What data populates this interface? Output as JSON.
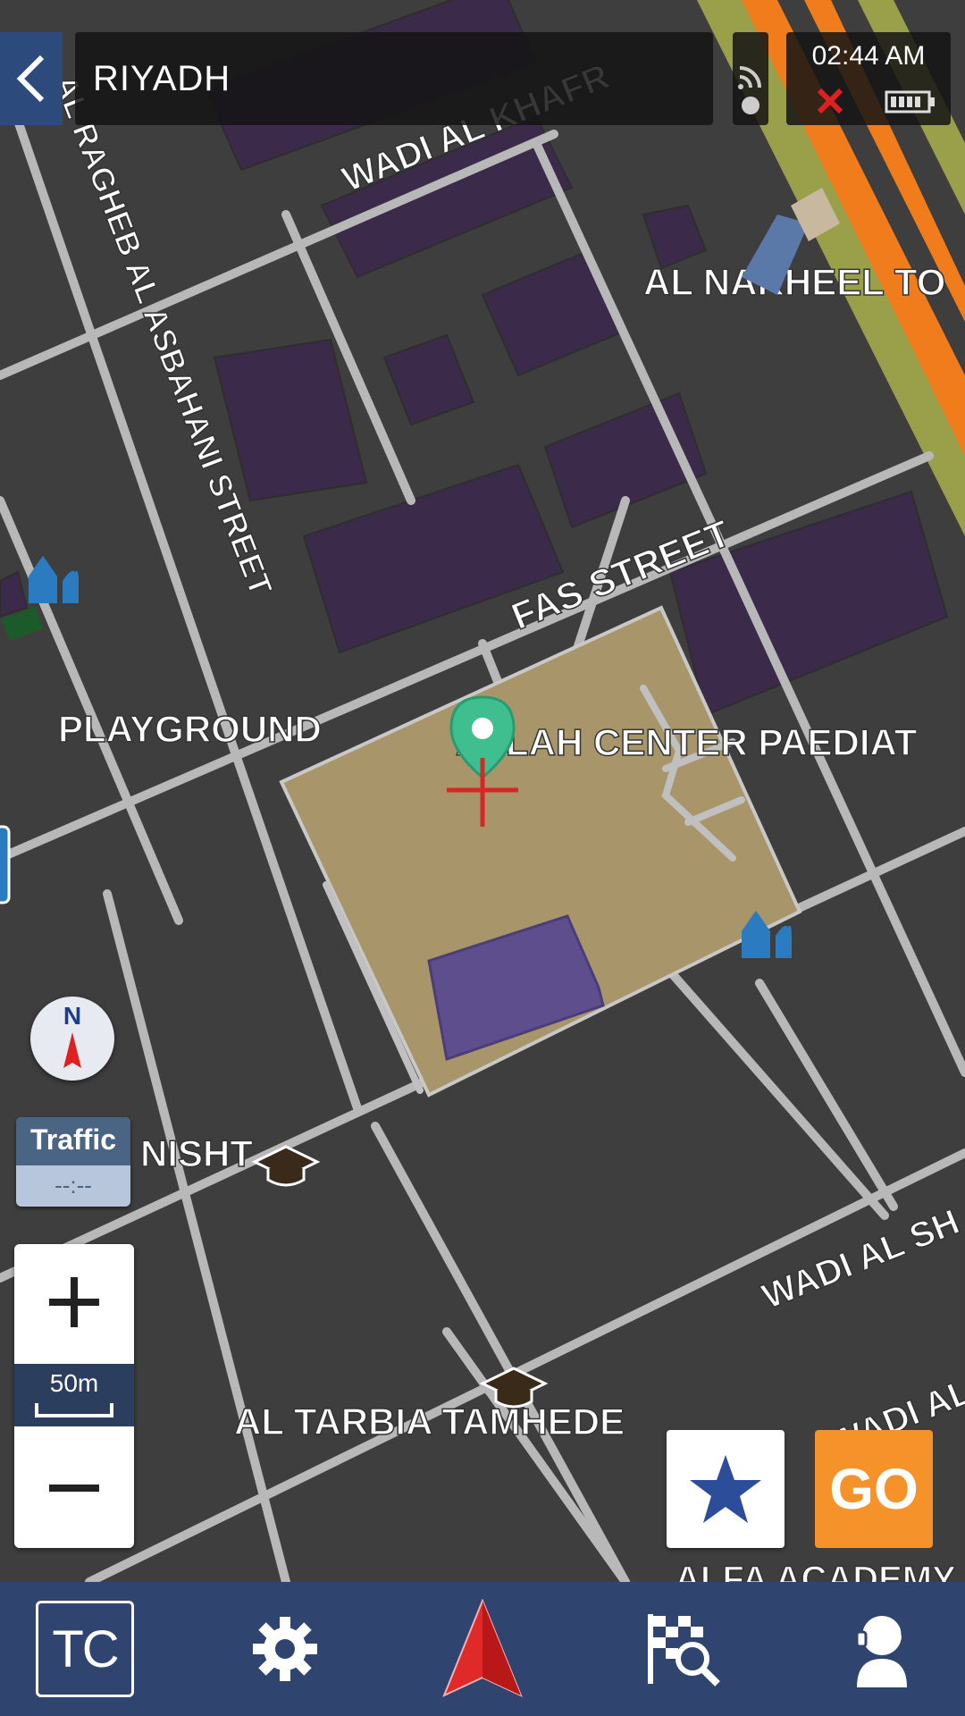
{
  "header": {
    "location_title": "RIYADH",
    "time": "02:44 AM"
  },
  "map": {
    "street_labels": {
      "wadi_al_khafr": "WADI AL KHAFR",
      "ragheb": "AL RAGHEB AL ASBAHANI STREET",
      "al_nakheel": "AL NAKHEEL TO",
      "fas_street": "FAS STREET",
      "playground": "PLAYGROUND",
      "center": "ALLAH CENTER PAEDIAT",
      "nisht": "NISHT",
      "wadi_al_sh": "WADI AL SH",
      "wadi_al_s2": "WADI AL S",
      "al_tarbia": "AL TARBIA TAMHEDE",
      "alfa_academy": "ALFA ACADEMY"
    }
  },
  "compass": {
    "label": "N"
  },
  "traffic": {
    "title": "Traffic",
    "value": "--:--"
  },
  "zoom": {
    "scale": "50m"
  },
  "actions": {
    "go_label": "GO"
  },
  "bottom_nav": {
    "tc_label": "TC"
  },
  "colors": {
    "accent_blue": "#2f456f",
    "go_orange": "#f5922a",
    "highway_orange": "#f07c1c",
    "building_purple": "#3d2b4a",
    "selected_area": "#a8966a"
  }
}
